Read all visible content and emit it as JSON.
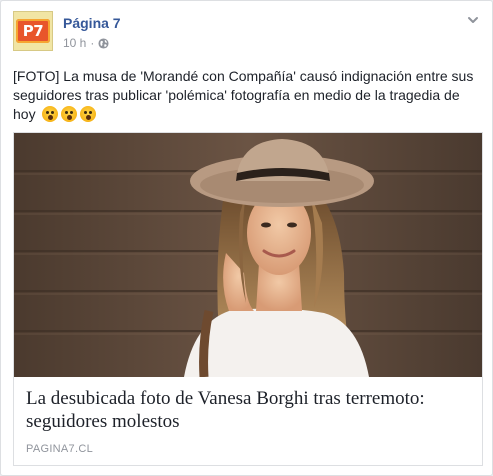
{
  "post": {
    "page_name": "Página 7",
    "avatar_text": "P7",
    "time": "10 h",
    "separator": "·",
    "text": "[FOTO] La musa de 'Morandé con Compañía' causó indignación entre sus seguidores tras publicar 'polémica' fotografía en medio de la tragedia de hoy",
    "emojis": [
      "astonished-face-emoji",
      "astonished-face-emoji",
      "astonished-face-emoji"
    ]
  },
  "link": {
    "title": "La desubicada foto de Vanesa Borghi tras terremoto: seguidores molestos",
    "domain": "PAGINA7.CL"
  },
  "colors": {
    "page_name": "#365899",
    "meta": "#90949c",
    "text": "#1d2129",
    "border": "#dddfe2"
  }
}
